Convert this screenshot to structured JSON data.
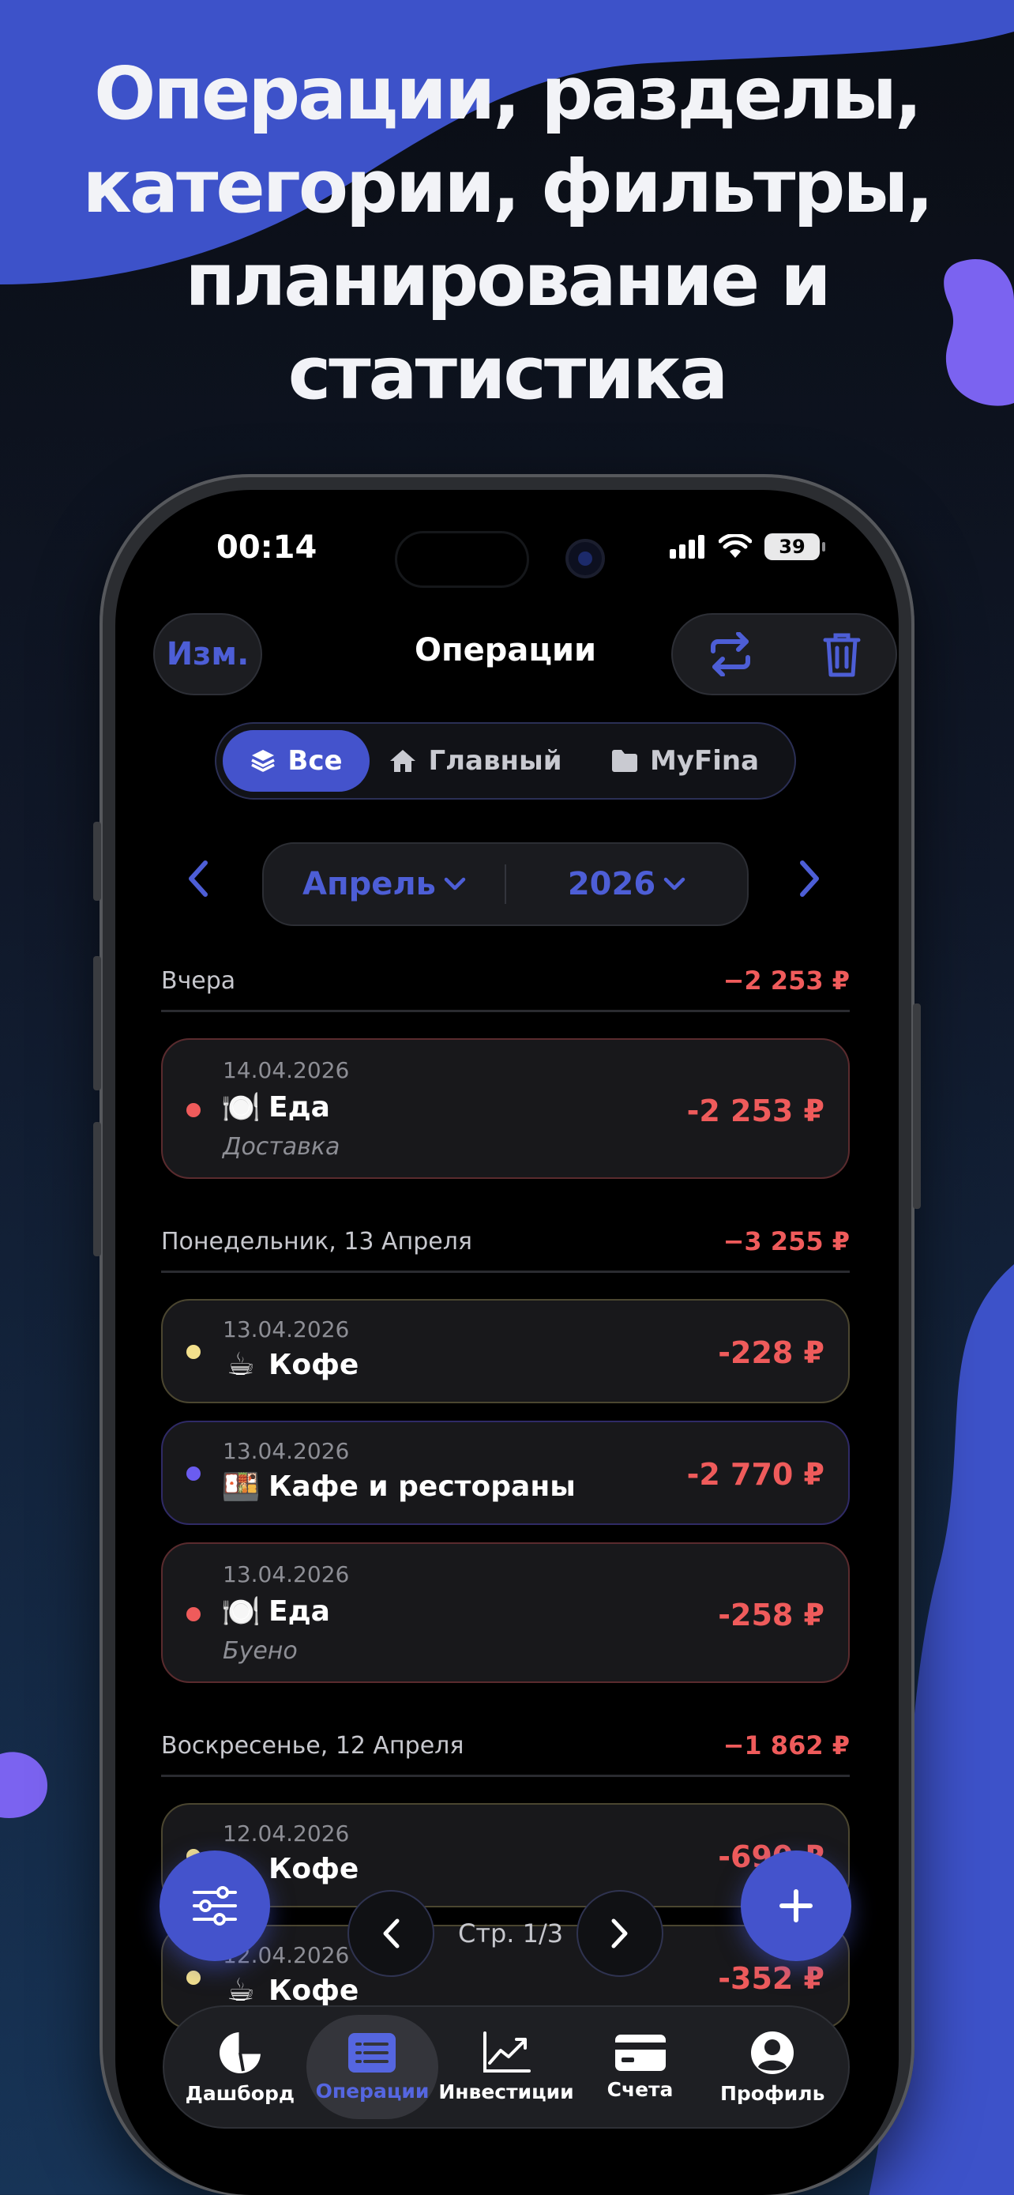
{
  "headline": {
    "lines": [
      "Операции, разделы,",
      "категории, фильтры,",
      "планирование и",
      "статистика"
    ]
  },
  "status_bar": {
    "time": "00:14",
    "battery": "39"
  },
  "nav": {
    "edit_label": "Изм.",
    "title": "Операции"
  },
  "segments": [
    {
      "label": "Все",
      "icon": "layers-icon",
      "active": true
    },
    {
      "label": "Главный",
      "icon": "home-icon",
      "active": false
    },
    {
      "label": "MyFina",
      "icon": "folder-icon",
      "active": false
    }
  ],
  "period": {
    "month": "Апрель",
    "year": "2026"
  },
  "sections": [
    {
      "title": "Вчера",
      "total": "−2 253 ₽",
      "items": [
        {
          "date": "14.04.2026",
          "emoji": "🍽️",
          "category": "Еда",
          "note": "Доставка",
          "amount": "-2 253 ₽",
          "dot_color": "#ef5b5b"
        }
      ]
    },
    {
      "title": "Понедельник, 13 Апреля",
      "total": "−3 255 ₽",
      "items": [
        {
          "date": "13.04.2026",
          "emoji": "☕",
          "category": "Кофе",
          "note": "",
          "amount": "-228 ₽",
          "dot_color": "#f3e08c"
        },
        {
          "date": "13.04.2026",
          "emoji": "🍱",
          "category": "Кафе и рестораны",
          "note": "",
          "amount": "-2 770 ₽",
          "dot_color": "#6b5cf0"
        },
        {
          "date": "13.04.2026",
          "emoji": "🍽️",
          "category": "Еда",
          "note": "Буено",
          "amount": "-258 ₽",
          "dot_color": "#ef5b5b"
        }
      ]
    },
    {
      "title": "Воскресенье, 12 Апреля",
      "total": "−1 862 ₽",
      "items": [
        {
          "date": "12.04.2026",
          "emoji": "☕",
          "category": "Кофе",
          "note": "",
          "amount": "-690 ₽",
          "dot_color": "#f3e08c"
        },
        {
          "date": "12.04.2026",
          "emoji": "☕",
          "category": "Кофе",
          "note": "",
          "amount": "-352 ₽",
          "dot_color": "#f3e08c"
        }
      ]
    }
  ],
  "pager": {
    "label": "Стр. 1/3"
  },
  "tabs": [
    {
      "label": "Дашборд",
      "icon": "pie-chart-icon",
      "active": false
    },
    {
      "label": "Операции",
      "icon": "list-icon",
      "active": true
    },
    {
      "label": "Инвестиции",
      "icon": "trend-chart-icon",
      "active": false
    },
    {
      "label": "Счета",
      "icon": "credit-card-icon",
      "active": false
    },
    {
      "label": "Профиль",
      "icon": "user-icon",
      "active": false
    }
  ],
  "colors": {
    "accent": "#4453cc",
    "expense": "#ef5b5b",
    "background_blob": "#3d52c9",
    "purple_blob": "#7b63f0"
  }
}
